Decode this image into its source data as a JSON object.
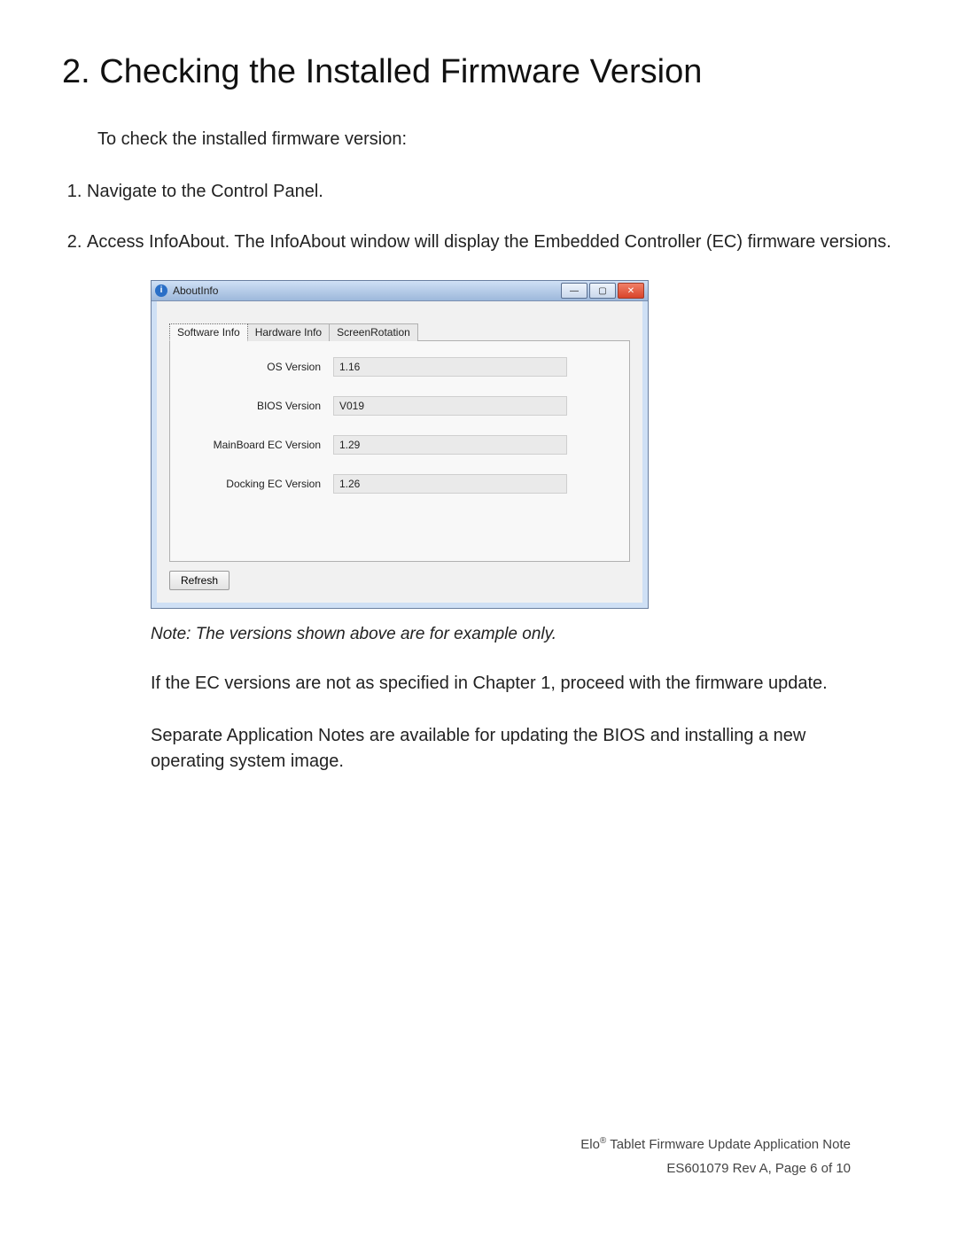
{
  "heading": "2. Checking the Installed Firmware Version",
  "intro": "To check the installed firmware version:",
  "steps": [
    "Navigate to the Control Panel.",
    "Access InfoAbout. The InfoAbout window will display the Embedded Controller (EC) firmware versions."
  ],
  "window": {
    "title": "AboutInfo",
    "tabs": [
      "Software Info",
      "Hardware Info",
      "ScreenRotation"
    ],
    "active_tab": 0,
    "fields": [
      {
        "label": "OS Version",
        "value": "1.16"
      },
      {
        "label": "BIOS Version",
        "value": "V019"
      },
      {
        "label": "MainBoard EC Version",
        "value": "1.29"
      },
      {
        "label": "Docking EC Version",
        "value": "1.26"
      }
    ],
    "refresh_label": "Refresh",
    "buttons": {
      "minimize": "—",
      "maximize": "▢",
      "close": "✕"
    }
  },
  "note": "Note: The versions shown above are for example only.",
  "para1": "If the EC versions are not as specified in Chapter 1, proceed with the firmware update.",
  "para2": "Separate Application Notes are available for updating the BIOS and installing a new operating system image.",
  "footer": {
    "brand_prefix": "Elo",
    "brand_suffix": " Tablet Firmware Update Application Note",
    "rev": "ES601079 Rev A, Page 6 of 10"
  }
}
